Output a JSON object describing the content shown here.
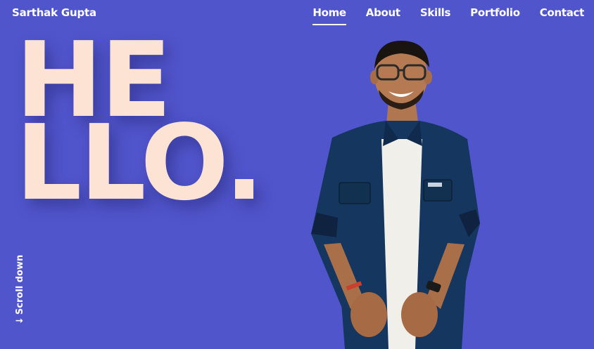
{
  "header": {
    "brand": "Sarthak Gupta",
    "nav": [
      {
        "label": "Home",
        "active": true
      },
      {
        "label": "About",
        "active": false
      },
      {
        "label": "Skills",
        "active": false
      },
      {
        "label": "Portfolio",
        "active": false
      },
      {
        "label": "Contact",
        "active": false
      }
    ]
  },
  "hero": {
    "line1": "HE",
    "line2": "LLO."
  },
  "scroll": {
    "arrow": "↓",
    "label": "Scroll down"
  },
  "colors": {
    "background": "#5155cc",
    "hero_text": "#fde3d3",
    "nav_text": "#ffffff"
  }
}
